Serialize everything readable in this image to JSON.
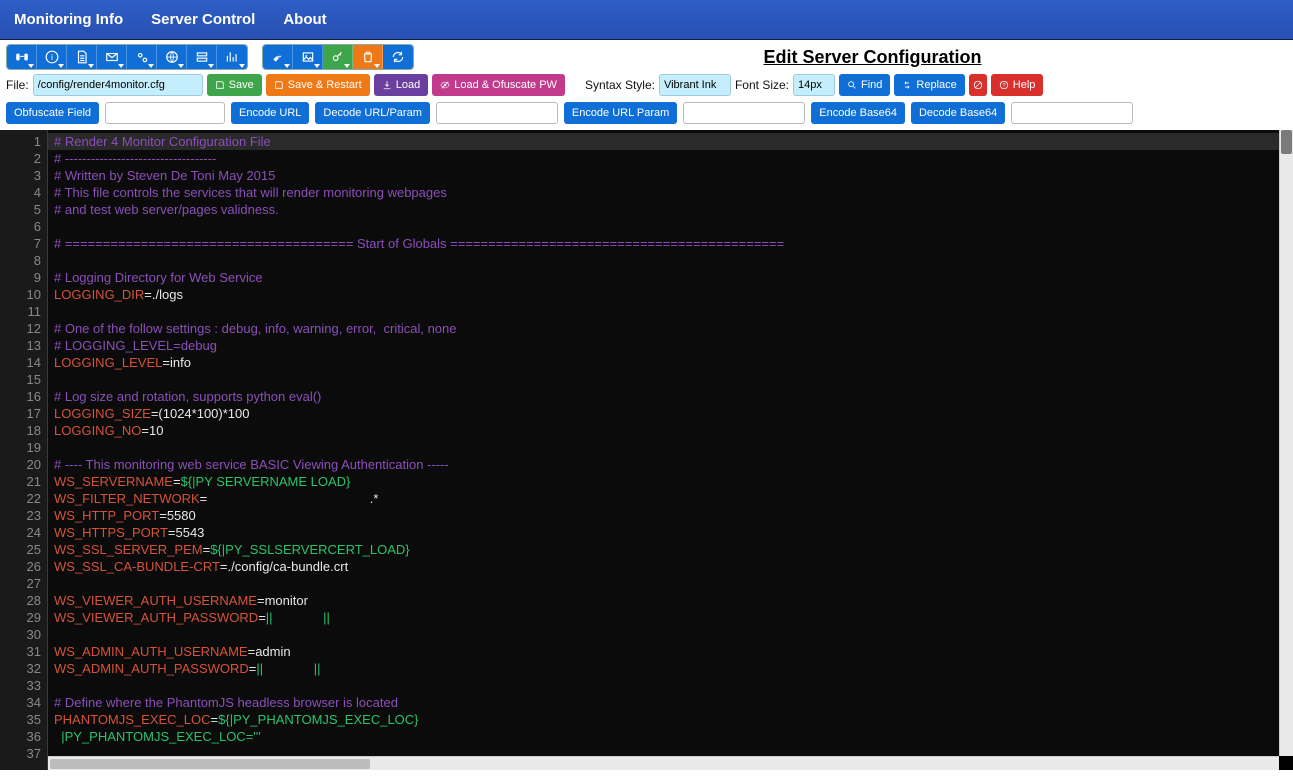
{
  "nav": {
    "monitoring": "Monitoring Info",
    "server": "Server Control",
    "about": "About"
  },
  "title": "Edit Server Configuration",
  "row2": {
    "file_lbl": "File:",
    "file_val": "/config/render4monitor.cfg",
    "save": "Save",
    "save_restart": "Save & Restart",
    "load": "Load",
    "load_ofus": "Load & Ofuscate PW",
    "syntax_lbl": "Syntax Style:",
    "syntax_val": "Vibrant Ink",
    "fontsize_lbl": "Font Size:",
    "fontsize_val": "14px",
    "find": "Find",
    "replace": "Replace",
    "help": "Help"
  },
  "row3": {
    "obf": "Obfuscate Field",
    "enc_url": "Encode URL",
    "dec_url": "Decode URL/Param",
    "enc_param": "Encode URL Param",
    "enc_b64": "Encode Base64",
    "dec_b64": "Decode Base64"
  },
  "editor": {
    "lines": [
      {
        "n": 1,
        "seg": [
          [
            "cmt",
            "# Render 4 Monitor Configuration File"
          ]
        ]
      },
      {
        "n": 2,
        "seg": [
          [
            "cmt",
            "# -----------------------------------"
          ]
        ]
      },
      {
        "n": 3,
        "seg": [
          [
            "cmt",
            "# Written by Steven De Toni May 2015"
          ]
        ]
      },
      {
        "n": 4,
        "seg": [
          [
            "cmt",
            "# This file controls the services that will render monitoring webpages"
          ]
        ]
      },
      {
        "n": 5,
        "seg": [
          [
            "cmt",
            "# and test web server/pages validness."
          ]
        ]
      },
      {
        "n": 6,
        "seg": []
      },
      {
        "n": 7,
        "seg": [
          [
            "cmt",
            "# ====================================== Start of Globals ============================================"
          ]
        ]
      },
      {
        "n": 8,
        "seg": []
      },
      {
        "n": 9,
        "seg": [
          [
            "cmt",
            "# Logging Directory for Web Service"
          ]
        ]
      },
      {
        "n": 10,
        "seg": [
          [
            "key",
            "LOGGING_DIR"
          ],
          [
            "eq",
            "="
          ],
          [
            "val",
            "./logs"
          ]
        ]
      },
      {
        "n": 11,
        "seg": []
      },
      {
        "n": 12,
        "seg": [
          [
            "cmt",
            "# One of the follow settings : debug, info, warning, error,  critical, none"
          ]
        ]
      },
      {
        "n": 13,
        "seg": [
          [
            "cmt",
            "# LOGGING_LEVEL=debug"
          ]
        ]
      },
      {
        "n": 14,
        "seg": [
          [
            "key",
            "LOGGING_LEVEL"
          ],
          [
            "eq",
            "="
          ],
          [
            "val",
            "info"
          ]
        ]
      },
      {
        "n": 15,
        "seg": []
      },
      {
        "n": 16,
        "seg": [
          [
            "cmt",
            "# Log size and rotation, supports python eval()"
          ]
        ]
      },
      {
        "n": 17,
        "seg": [
          [
            "key",
            "LOGGING_SIZE"
          ],
          [
            "eq",
            "="
          ],
          [
            "val",
            "(1024*100)*100"
          ]
        ]
      },
      {
        "n": 18,
        "seg": [
          [
            "key",
            "LOGGING_NO"
          ],
          [
            "eq",
            "="
          ],
          [
            "val",
            "10"
          ]
        ]
      },
      {
        "n": 19,
        "seg": []
      },
      {
        "n": 20,
        "seg": [
          [
            "cmt",
            "# ---- This monitoring web service BASIC Viewing Authentication -----"
          ]
        ]
      },
      {
        "n": 21,
        "seg": [
          [
            "key",
            "WS_SERVERNAME"
          ],
          [
            "eq",
            "="
          ],
          [
            "mac",
            "${|PY SERVERNAME LOAD}"
          ]
        ]
      },
      {
        "n": 22,
        "seg": [
          [
            "key",
            "WS_FILTER_NETWORK"
          ],
          [
            "eq",
            "="
          ],
          [
            "val",
            "                                             .*"
          ]
        ]
      },
      {
        "n": 23,
        "seg": [
          [
            "key",
            "WS_HTTP_PORT"
          ],
          [
            "eq",
            "="
          ],
          [
            "val",
            "5580"
          ]
        ]
      },
      {
        "n": 24,
        "seg": [
          [
            "key",
            "WS_HTTPS_PORT"
          ],
          [
            "eq",
            "="
          ],
          [
            "val",
            "5543"
          ]
        ]
      },
      {
        "n": 25,
        "seg": [
          [
            "key",
            "WS_SSL_SERVER_PEM"
          ],
          [
            "eq",
            "="
          ],
          [
            "mac",
            "${|PY_SSLSERVERCERT_LOAD}"
          ]
        ]
      },
      {
        "n": 26,
        "seg": [
          [
            "key",
            "WS_SSL_CA-BUNDLE-CRT"
          ],
          [
            "eq",
            "="
          ],
          [
            "val",
            "./config/ca-bundle.crt"
          ]
        ]
      },
      {
        "n": 27,
        "seg": []
      },
      {
        "n": 28,
        "seg": [
          [
            "key",
            "WS_VIEWER_AUTH_USERNAME"
          ],
          [
            "eq",
            "="
          ],
          [
            "val",
            "monitor"
          ]
        ]
      },
      {
        "n": 29,
        "seg": [
          [
            "key",
            "WS_VIEWER_AUTH_PASSWORD"
          ],
          [
            "eq",
            "="
          ],
          [
            "mac",
            "||              ||"
          ]
        ]
      },
      {
        "n": 30,
        "seg": []
      },
      {
        "n": 31,
        "seg": [
          [
            "key",
            "WS_ADMIN_AUTH_USERNAME"
          ],
          [
            "eq",
            "="
          ],
          [
            "val",
            "admin"
          ]
        ]
      },
      {
        "n": 32,
        "seg": [
          [
            "key",
            "WS_ADMIN_AUTH_PASSWORD"
          ],
          [
            "eq",
            "="
          ],
          [
            "mac",
            "||              ||"
          ]
        ]
      },
      {
        "n": 33,
        "seg": []
      },
      {
        "n": 34,
        "seg": [
          [
            "cmt",
            "# Define where the PhantomJS headless browser is located"
          ]
        ]
      },
      {
        "n": 35,
        "seg": [
          [
            "key",
            "PHANTOMJS_EXEC_LOC"
          ],
          [
            "eq",
            "="
          ],
          [
            "mac",
            "${|PY_PHANTOMJS_EXEC_LOC}"
          ]
        ]
      },
      {
        "n": 36,
        "seg": [
          [
            "mac",
            "  |PY_PHANTOMJS_EXEC_LOC='''"
          ]
        ]
      },
      {
        "n": 37,
        "seg": []
      }
    ]
  }
}
